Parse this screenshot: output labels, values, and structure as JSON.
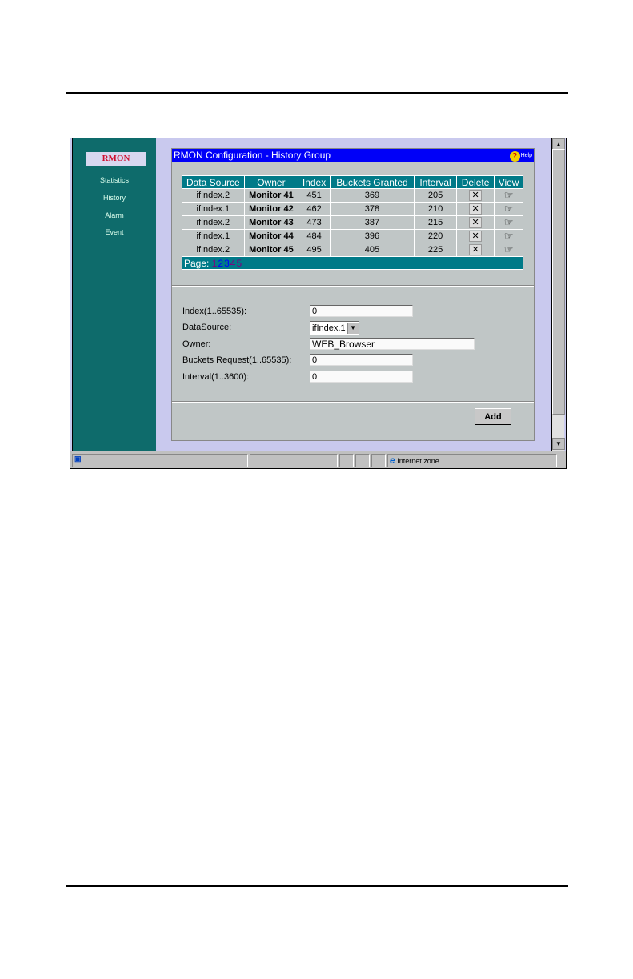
{
  "sidebar": {
    "brand": "RMON",
    "items": [
      "Statistics",
      "History",
      "Alarm",
      "Event"
    ]
  },
  "panel": {
    "title": "RMON Configuration - History Group",
    "help_label": "Help"
  },
  "table": {
    "headers": [
      "Data Source",
      "Owner",
      "Index",
      "Buckets Granted",
      "Interval",
      "Delete",
      "View"
    ],
    "rows": [
      [
        "ifIndex.2",
        "Monitor 41",
        "451",
        "369",
        "205"
      ],
      [
        "ifIndex.1",
        "Monitor 42",
        "462",
        "378",
        "210"
      ],
      [
        "ifIndex.2",
        "Monitor 43",
        "473",
        "387",
        "215"
      ],
      [
        "ifIndex.1",
        "Monitor 44",
        "484",
        "396",
        "220"
      ],
      [
        "ifIndex.2",
        "Monitor 45",
        "495",
        "405",
        "225"
      ]
    ],
    "page_label": "Page:",
    "pages": [
      "1",
      "2",
      "3",
      "4",
      "5"
    ]
  },
  "form": {
    "index_label": "Index(1..65535):",
    "index_value": "0",
    "datasource_label": "DataSource:",
    "datasource_value": "ifIndex.1",
    "owner_label": "Owner:",
    "owner_value": "WEB_Browser",
    "buckets_label": "Buckets Request(1..65535):",
    "buckets_value": "0",
    "interval_label": "Interval(1..3600):",
    "interval_value": "0",
    "add_label": "Add"
  },
  "status": {
    "zone": "Internet zone"
  },
  "colors": {
    "sidebar": "#0e6b6b",
    "titlebar": "#0000f8",
    "table_header": "#007a88",
    "brand": "#d01030"
  }
}
